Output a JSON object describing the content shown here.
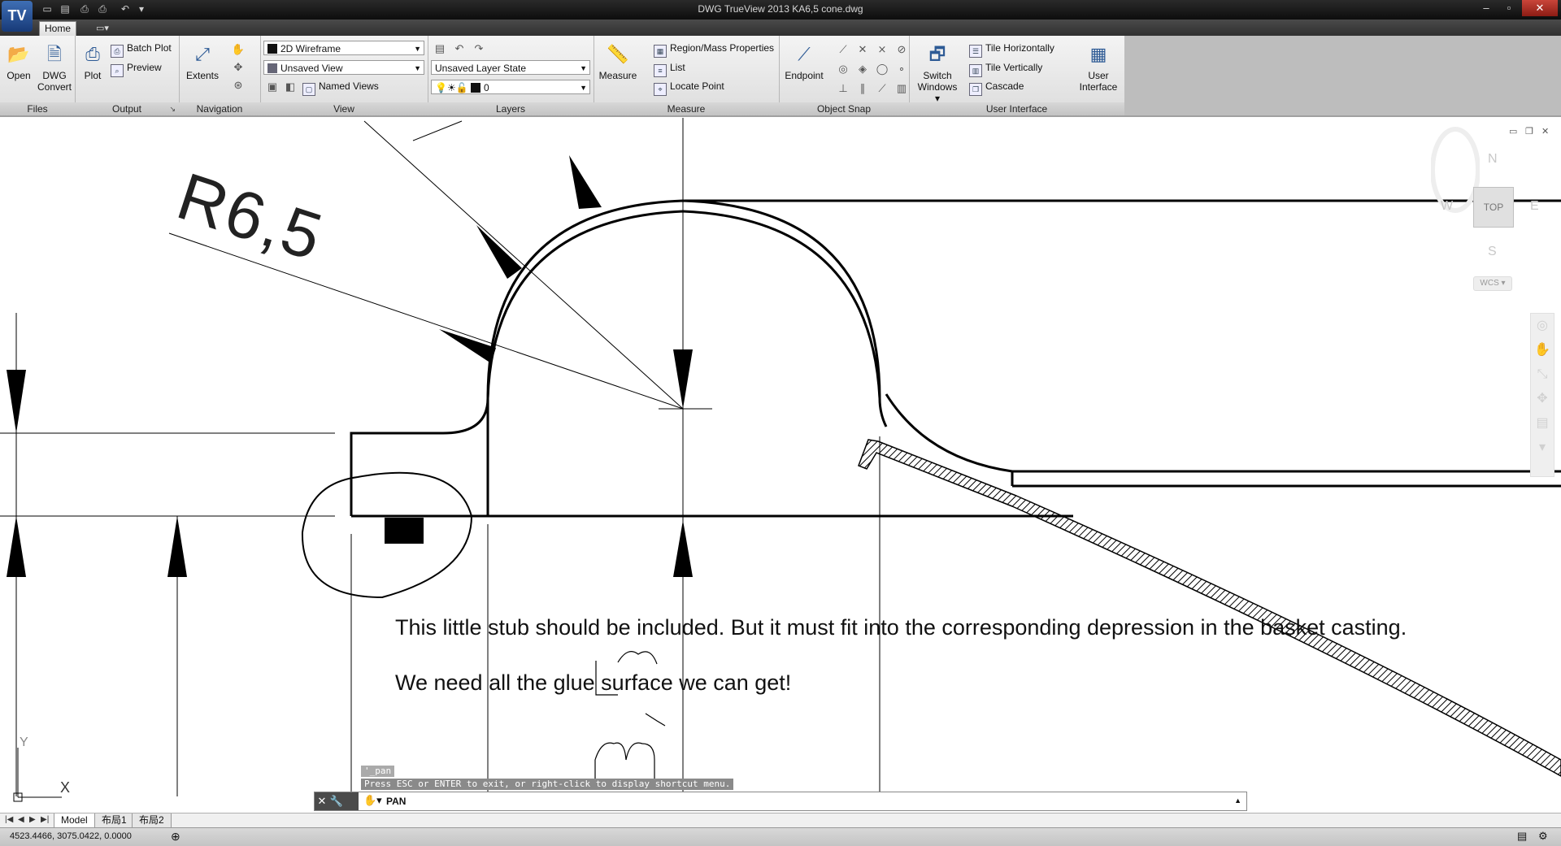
{
  "window": {
    "title": "DWG TrueView 2013    KA6,5 cone.dwg",
    "app_button": "TV"
  },
  "ribbon": {
    "tabs": [
      {
        "label": "Home"
      }
    ],
    "panels": {
      "files": {
        "title": "Files",
        "open": "Open",
        "dwg_convert_1": "DWG",
        "dwg_convert_2": "Convert"
      },
      "output": {
        "title": "Output",
        "plot": "Plot",
        "batch_plot": "Batch Plot",
        "preview": "Preview"
      },
      "navigation": {
        "title": "Navigation",
        "extents": "Extents"
      },
      "view": {
        "title": "View",
        "visual_style": "2D Wireframe",
        "saved_view": "Unsaved View",
        "named_views": "Named Views"
      },
      "layers": {
        "title": "Layers",
        "layer_state": "Unsaved Layer State",
        "current_layer": "0"
      },
      "measure": {
        "title": "Measure",
        "measure": "Measure",
        "region_mass": "Region/Mass Properties",
        "list": "List",
        "locate_point": "Locate Point"
      },
      "object_snap": {
        "title": "Object Snap",
        "endpoint": "Endpoint"
      },
      "user_interface": {
        "title": "User Interface",
        "switch_1": "Switch",
        "switch_2": "Windows",
        "tile_h": "Tile Horizontally",
        "tile_v": "Tile Vertically",
        "cascade": "Cascade",
        "ui_1": "User",
        "ui_2": "Interface"
      }
    }
  },
  "viewcube": {
    "north": "N",
    "south": "S",
    "east": "E",
    "west": "W",
    "face": "TOP",
    "wcs": "WCS"
  },
  "drawing": {
    "dimension_text": "R6,5",
    "note_line_1": "This little stub should be included.  But it must fit into the corresponding depression in the basket casting.",
    "note_line_2": "We need all the glue surface we can get!",
    "ucs_x": "X",
    "ucs_y": "Y"
  },
  "command": {
    "history_1": "'_pan",
    "history_2": "Press ESC or ENTER to exit, or right-click to display shortcut menu.",
    "current": "PAN"
  },
  "layout_tabs": [
    {
      "label": "Model"
    },
    {
      "label": "布局1"
    },
    {
      "label": "布局2"
    }
  ],
  "status": {
    "coordinates": "4523.4466, 3075.0422, 0.0000"
  },
  "colors": {
    "accent": "#2d5a95",
    "titlebar": "#1a1a1a",
    "ribbon": "#e8e8e8"
  }
}
